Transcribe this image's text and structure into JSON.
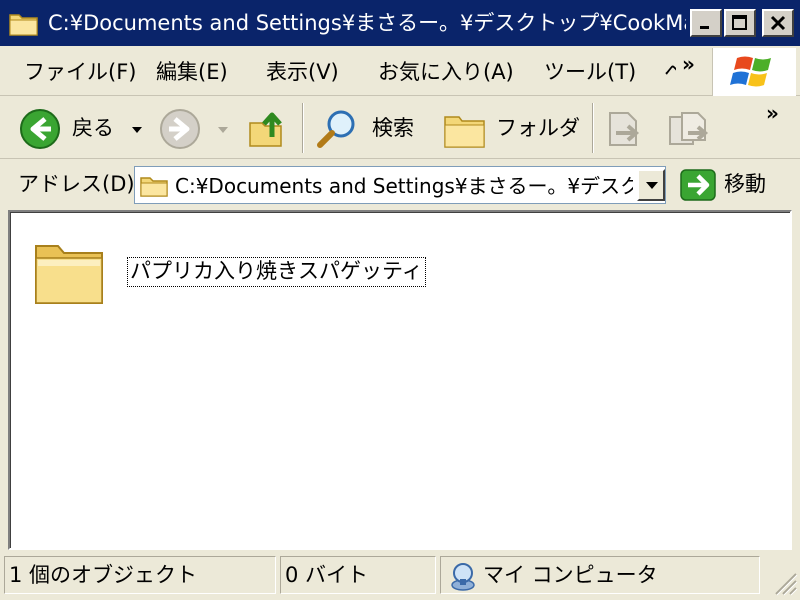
{
  "window": {
    "title": "C:¥Documents and Settings¥まさるー。¥デスクトップ¥CookManag..."
  },
  "menu": {
    "items": [
      {
        "label": "ファイル(F)"
      },
      {
        "label": "編集(E)"
      },
      {
        "label": "表示(V)"
      },
      {
        "label": "お気に入り(A)"
      },
      {
        "label": "ツール(T)"
      },
      {
        "label": "ヘ"
      }
    ],
    "overflow": "»"
  },
  "toolbar": {
    "back_label": "戻る",
    "search_label": "検索",
    "folders_label": "フォルダ",
    "overflow": "»"
  },
  "address": {
    "label": "アドレス(D)",
    "value": "C:¥Documents and Settings¥まさるー。¥デスク",
    "go_label": "移動"
  },
  "content": {
    "items": [
      {
        "name": "パプリカ入り焼きスパゲッティ",
        "icon": "folder-icon"
      }
    ]
  },
  "status": {
    "objects": "1 個のオブジェクト",
    "size": "0 バイト",
    "zone": "マイ コンピュータ"
  }
}
